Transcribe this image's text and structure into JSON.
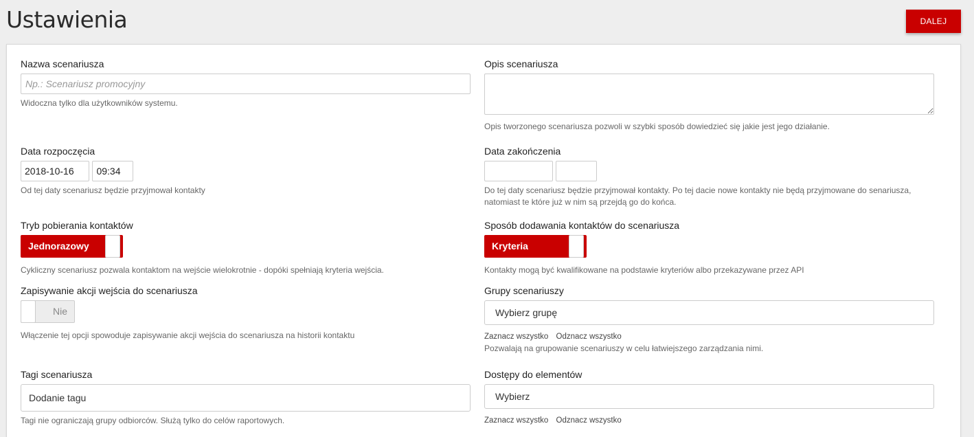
{
  "header": {
    "title": "Ustawienia",
    "next_label": "DALEJ",
    "accent_color": "#c90000"
  },
  "form": {
    "name": {
      "label": "Nazwa scenariusza",
      "placeholder": "Np.: Scenariusz promocyjny",
      "value": "",
      "help": "Widoczna tylko dla użytkowników systemu."
    },
    "description": {
      "label": "Opis scenariusza",
      "value": "",
      "help": "Opis tworzonego scenariusza pozwoli w szybki sposób dowiedzieć się jakie jest jego działanie."
    },
    "start": {
      "label": "Data rozpoczęcia",
      "date": "2018-10-16",
      "time": "09:34",
      "help": "Od tej daty scenariusz będzie przyjmował kontakty"
    },
    "end": {
      "label": "Data zakończenia",
      "date": "",
      "time": "",
      "help": "Do tej daty scenariusz będzie przyjmował kontakty. Po tej dacie nowe kontakty nie będą przyjmowane do senariusza, natomiast te które już w nim są przejdą go do końca."
    },
    "fetch_mode": {
      "label": "Tryb pobierania kontaktów",
      "toggle_label": "Jednorazowy",
      "state": "on",
      "help": "Cykliczny scenariusz pozwala kontaktom na wejście wielokrotnie - dopóki spełniają kryteria wejścia."
    },
    "add_mode": {
      "label": "Sposób dodawania kontaktów do scenariusza",
      "toggle_label": "Kryteria",
      "state": "on",
      "help": "Kontakty mogą być kwalifikowane na podstawie kryteriów albo przekazywane przez API"
    },
    "save_entry": {
      "label": "Zapisywanie akcji wejścia do scenariusza",
      "toggle_label": "Nie",
      "state": "off",
      "help": "Włączenie tej opcji spowoduje zapisywanie akcji wejścia do scenariusza na historii kontaktu"
    },
    "groups": {
      "label": "Grupy scenariuszy",
      "placeholder": "Wybierz grupę",
      "select_all": "Zaznacz wszystko",
      "deselect_all": "Odznacz wszystko",
      "help": "Pozwalają na grupowanie scenariuszy w celu łatwiejszego zarządzania nimi."
    },
    "tags": {
      "label": "Tagi scenariusza",
      "placeholder": "Dodanie tagu",
      "help": "Tagi nie ograniczają grupy odbiorców. Służą tylko do celów raportowych."
    },
    "access": {
      "label": "Dostępy do elementów",
      "placeholder": "Wybierz",
      "select_all": "Zaznacz wszystko",
      "deselect_all": "Odznacz wszystko"
    }
  }
}
